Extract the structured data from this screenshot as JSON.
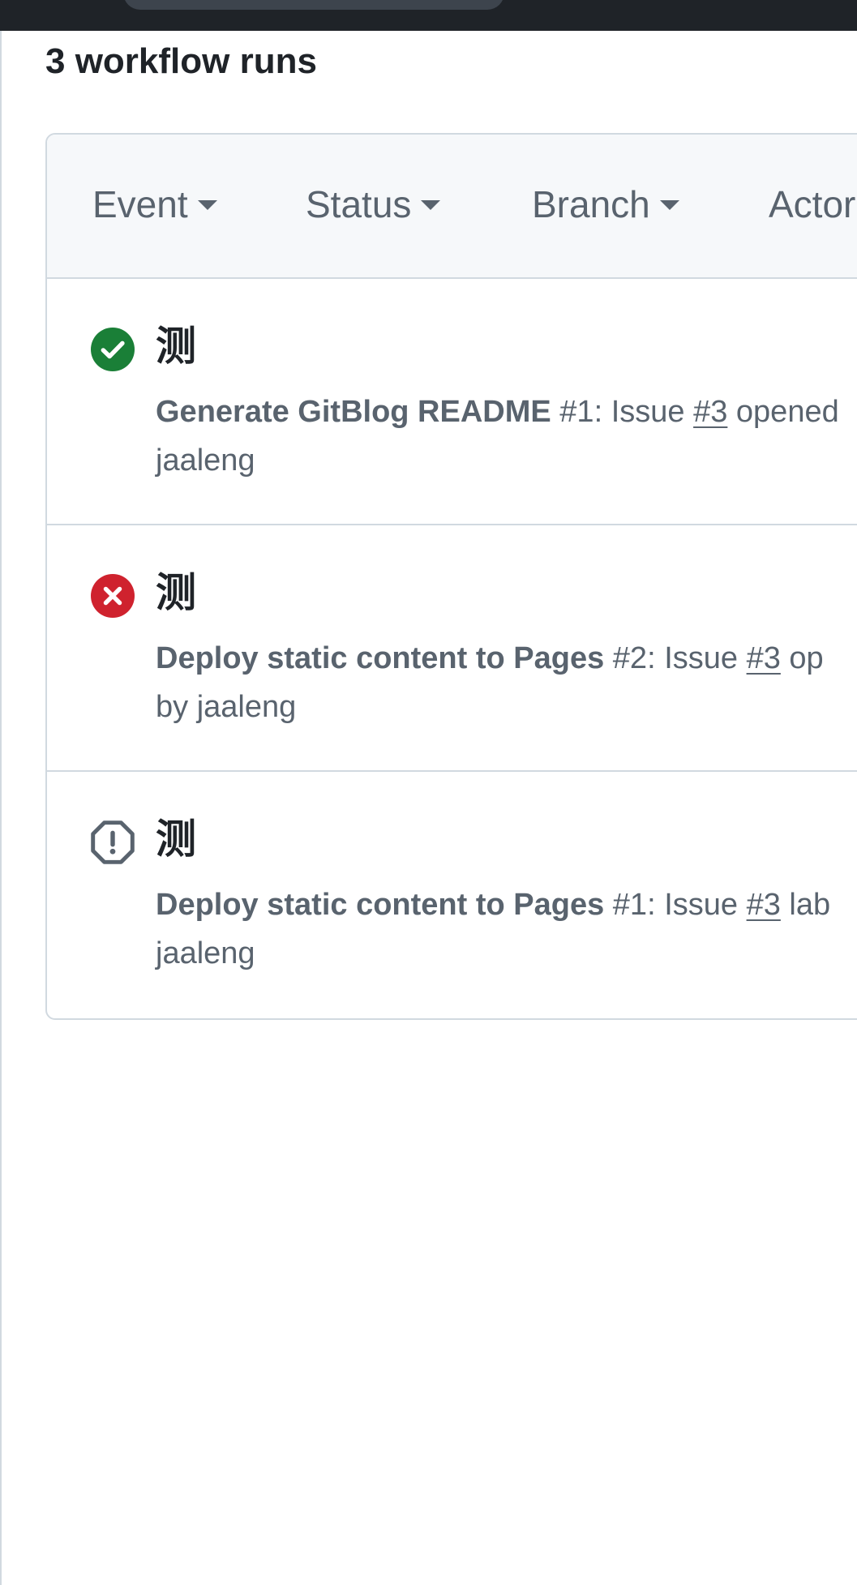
{
  "page": {
    "title": "3 workflow runs"
  },
  "filters": [
    {
      "label": "Event"
    },
    {
      "label": "Status"
    },
    {
      "label": "Branch"
    },
    {
      "label": "Actor"
    }
  ],
  "runs": [
    {
      "status": "success",
      "status_icon": "check-circle-fill-icon",
      "status_color": "#1a7f37",
      "title": "测",
      "workflow": "Generate GitBlog README",
      "run_number": "#1",
      "event_prefix": ": Issue ",
      "issue_ref": "#3",
      "event_suffix": " opened",
      "line2": "jaaleng"
    },
    {
      "status": "failure",
      "status_icon": "x-circle-fill-icon",
      "status_color": "#cf222e",
      "title": "测",
      "workflow": "Deploy static content to Pages",
      "run_number": "#2",
      "event_prefix": ": Issue ",
      "issue_ref": "#3",
      "event_suffix": " op",
      "line2": "by jaaleng"
    },
    {
      "status": "action_required",
      "status_icon": "alert-octagon-icon",
      "status_color": "#59636e",
      "title": "测",
      "workflow": "Deploy static content to Pages",
      "run_number": "#1",
      "event_prefix": ": Issue ",
      "issue_ref": "#3",
      "event_suffix": " lab",
      "line2": "jaaleng"
    }
  ]
}
